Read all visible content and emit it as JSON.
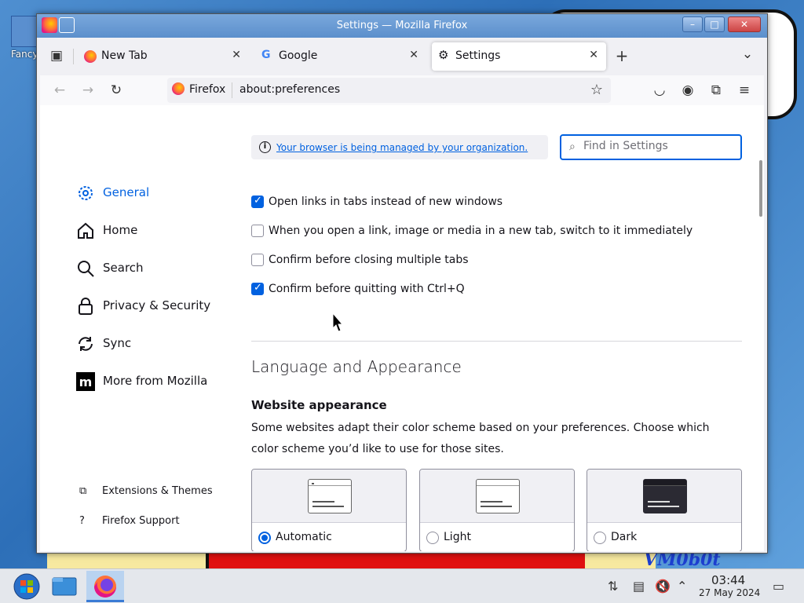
{
  "desktop": {
    "icon_label": "Fancy",
    "wallpaper_text": "VM0b0t"
  },
  "window": {
    "title": "Settings — Mozilla Firefox",
    "controls": {
      "minimize": "–",
      "maximize": "□",
      "close": "✕"
    }
  },
  "tabs": [
    {
      "label": "New Tab",
      "icon": "firefox-icon",
      "close": "✕"
    },
    {
      "label": "Google",
      "icon": "google-icon",
      "close": "✕"
    },
    {
      "label": "Settings",
      "icon": "gear-icon",
      "close": "✕",
      "active": true
    }
  ],
  "tabstrip": {
    "new_tab": "+",
    "list_all": "⌄"
  },
  "navbar": {
    "identity_label": "Firefox",
    "url": "about:preferences"
  },
  "sidebar": {
    "categories": [
      {
        "label": "General",
        "icon": "gear-icon",
        "selected": true
      },
      {
        "label": "Home",
        "icon": "home-icon"
      },
      {
        "label": "Search",
        "icon": "search-icon"
      },
      {
        "label": "Privacy & Security",
        "icon": "lock-icon"
      },
      {
        "label": "Sync",
        "icon": "sync-icon"
      },
      {
        "label": "More from Mozilla",
        "icon": "mozilla-icon"
      }
    ],
    "footer": [
      {
        "label": "Extensions & Themes",
        "icon": "puzzle-icon"
      },
      {
        "label": "Firefox Support",
        "icon": "help-icon"
      }
    ]
  },
  "policies": {
    "text": "Your browser is being managed by your organization."
  },
  "search": {
    "placeholder": "Find in Settings"
  },
  "tabs_settings": [
    {
      "label": "Open links in tabs instead of new windows",
      "checked": true
    },
    {
      "label": "When you open a link, image or media in a new tab, switch to it immediately",
      "checked": false
    },
    {
      "label": "Confirm before closing multiple tabs",
      "checked": false
    },
    {
      "label": "Confirm before quitting with Ctrl+Q",
      "checked": true
    }
  ],
  "language_appearance": {
    "title": "Language and Appearance",
    "website_appearance": "Website appearance",
    "description": "Some websites adapt their color scheme based on your preferences. Choose which color scheme you’d like to use for those sites.",
    "schemes": [
      {
        "label": "Automatic",
        "selected": true
      },
      {
        "label": "Light",
        "selected": false
      },
      {
        "label": "Dark",
        "selected": false
      }
    ]
  },
  "taskbar": {
    "clock_time": "03:44",
    "clock_date": "27 May 2024"
  },
  "colors": {
    "accent": "#0061e0",
    "titlebar": "#5b8fcc"
  }
}
